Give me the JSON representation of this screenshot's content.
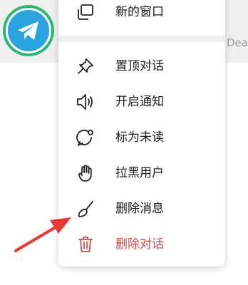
{
  "peek_text": "Dea",
  "menu": {
    "items": [
      {
        "label": "新的窗口",
        "icon": "new-window-icon"
      },
      {
        "label": "置顶对话",
        "icon": "pin-icon"
      },
      {
        "label": "开启通知",
        "icon": "speaker-icon"
      },
      {
        "label": "标为未读",
        "icon": "unread-bubble-icon"
      },
      {
        "label": "拉黑用户",
        "icon": "hand-block-icon"
      },
      {
        "label": "删除消息",
        "icon": "broom-icon"
      },
      {
        "label": "删除对话",
        "icon": "trash-icon"
      }
    ]
  },
  "colors": {
    "telegram_blue": "#2aa4df",
    "ring_green": "#2bb673",
    "danger_red": "#cf4b4b",
    "arrow_red": "#e8382f"
  }
}
